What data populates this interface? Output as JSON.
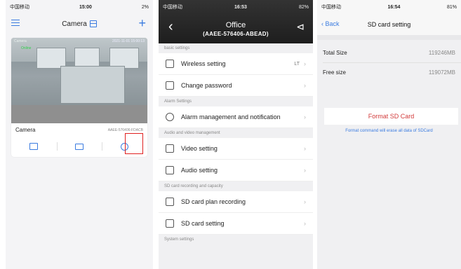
{
  "panel1": {
    "status": {
      "carrier": "中国移动",
      "time": "15:00",
      "battery": "2%"
    },
    "title": "Camera",
    "video": {
      "label": "Camera",
      "datetime": "2021-11-01 15:00:13",
      "online": "Online"
    },
    "camera": {
      "name": "Camera",
      "id": "AAEE-576406-FDACB"
    },
    "tools": [
      "playback-icon",
      "folder-icon",
      "settings-icon"
    ]
  },
  "panel2": {
    "status": {
      "carrier": "中国移动",
      "time": "16:53",
      "battery": "82%"
    },
    "title": "Office",
    "subtitle": "(AAEE-576406-ABEAD)",
    "sections": [
      {
        "header": "basic settings",
        "rows": [
          {
            "label": "Wireless setting",
            "value": "LT",
            "icon": "wifi-icon"
          },
          {
            "label": "Change password",
            "value": "",
            "icon": "lock-icon"
          }
        ]
      },
      {
        "header": "Alarm Settings",
        "rows": [
          {
            "label": "Alarm management and notification",
            "value": "",
            "icon": "alarm-icon"
          }
        ]
      },
      {
        "header": "Audio and video management",
        "rows": [
          {
            "label": "Video setting",
            "value": "",
            "icon": "video-icon"
          },
          {
            "label": "Audio setting",
            "value": "",
            "icon": "speaker-icon"
          }
        ]
      },
      {
        "header": "SD card recording and capacity",
        "rows": [
          {
            "label": "SD card plan recording",
            "value": "",
            "icon": "record-icon"
          },
          {
            "label": "SD card setting",
            "value": "",
            "icon": "sdcard-icon"
          }
        ]
      },
      {
        "header": "System settings",
        "rows": []
      }
    ]
  },
  "panel3": {
    "status": {
      "carrier": "中国移动",
      "time": "16:54",
      "battery": "81%"
    },
    "back": "Back",
    "title": "SD card setting",
    "total_label": "Total Size",
    "total_value": "119246MB",
    "free_label": "Free size",
    "free_value": "119072MB",
    "format_button": "Format SD Card",
    "format_note": "Format command will erase all data of SDCard"
  },
  "colors": {
    "accent": "#3a7be0",
    "danger": "#d23b3b",
    "highlight": "#e02020"
  }
}
